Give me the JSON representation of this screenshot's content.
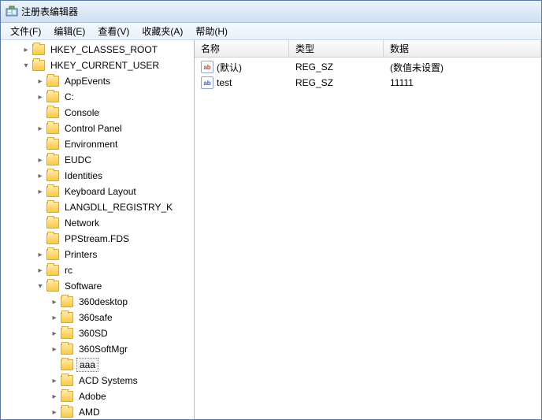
{
  "window": {
    "title": "注册表编辑器"
  },
  "menu": {
    "file": "文件(F)",
    "edit": "编辑(E)",
    "view": "查看(V)",
    "favorites": "收藏夹(A)",
    "help": "帮助(H)"
  },
  "columns": {
    "name": "名称",
    "type": "类型",
    "data": "数据"
  },
  "tree": [
    {
      "label": "HKEY_CLASSES_ROOT",
      "depth": 1,
      "expand": "closed"
    },
    {
      "label": "HKEY_CURRENT_USER",
      "depth": 1,
      "expand": "open",
      "children": [
        {
          "label": "AppEvents",
          "depth": 2,
          "expand": "closed"
        },
        {
          "label": "C:",
          "depth": 2,
          "expand": "closed"
        },
        {
          "label": "Console",
          "depth": 2,
          "expand": "none"
        },
        {
          "label": "Control Panel",
          "depth": 2,
          "expand": "closed"
        },
        {
          "label": "Environment",
          "depth": 2,
          "expand": "none"
        },
        {
          "label": "EUDC",
          "depth": 2,
          "expand": "closed"
        },
        {
          "label": "Identities",
          "depth": 2,
          "expand": "closed"
        },
        {
          "label": "Keyboard Layout",
          "depth": 2,
          "expand": "closed"
        },
        {
          "label": "LANGDLL_REGISTRY_K",
          "depth": 2,
          "expand": "none"
        },
        {
          "label": "Network",
          "depth": 2,
          "expand": "none"
        },
        {
          "label": "PPStream.FDS",
          "depth": 2,
          "expand": "none"
        },
        {
          "label": "Printers",
          "depth": 2,
          "expand": "closed"
        },
        {
          "label": "rc",
          "depth": 2,
          "expand": "closed"
        },
        {
          "label": "Software",
          "depth": 2,
          "expand": "open",
          "children": [
            {
              "label": "360desktop",
              "depth": 3,
              "expand": "closed"
            },
            {
              "label": "360safe",
              "depth": 3,
              "expand": "closed"
            },
            {
              "label": "360SD",
              "depth": 3,
              "expand": "closed"
            },
            {
              "label": "360SoftMgr",
              "depth": 3,
              "expand": "closed"
            },
            {
              "label": "aaa",
              "depth": 3,
              "expand": "none",
              "selected": true
            },
            {
              "label": "ACD Systems",
              "depth": 3,
              "expand": "closed"
            },
            {
              "label": "Adobe",
              "depth": 3,
              "expand": "closed"
            },
            {
              "label": "AMD",
              "depth": 3,
              "expand": "closed"
            }
          ]
        }
      ]
    }
  ],
  "values": [
    {
      "name": "(默认)",
      "type": "REG_SZ",
      "data": "(数值未设置)",
      "icon": "str"
    },
    {
      "name": "test",
      "type": "REG_SZ",
      "data": "11111",
      "icon": "bin"
    }
  ]
}
